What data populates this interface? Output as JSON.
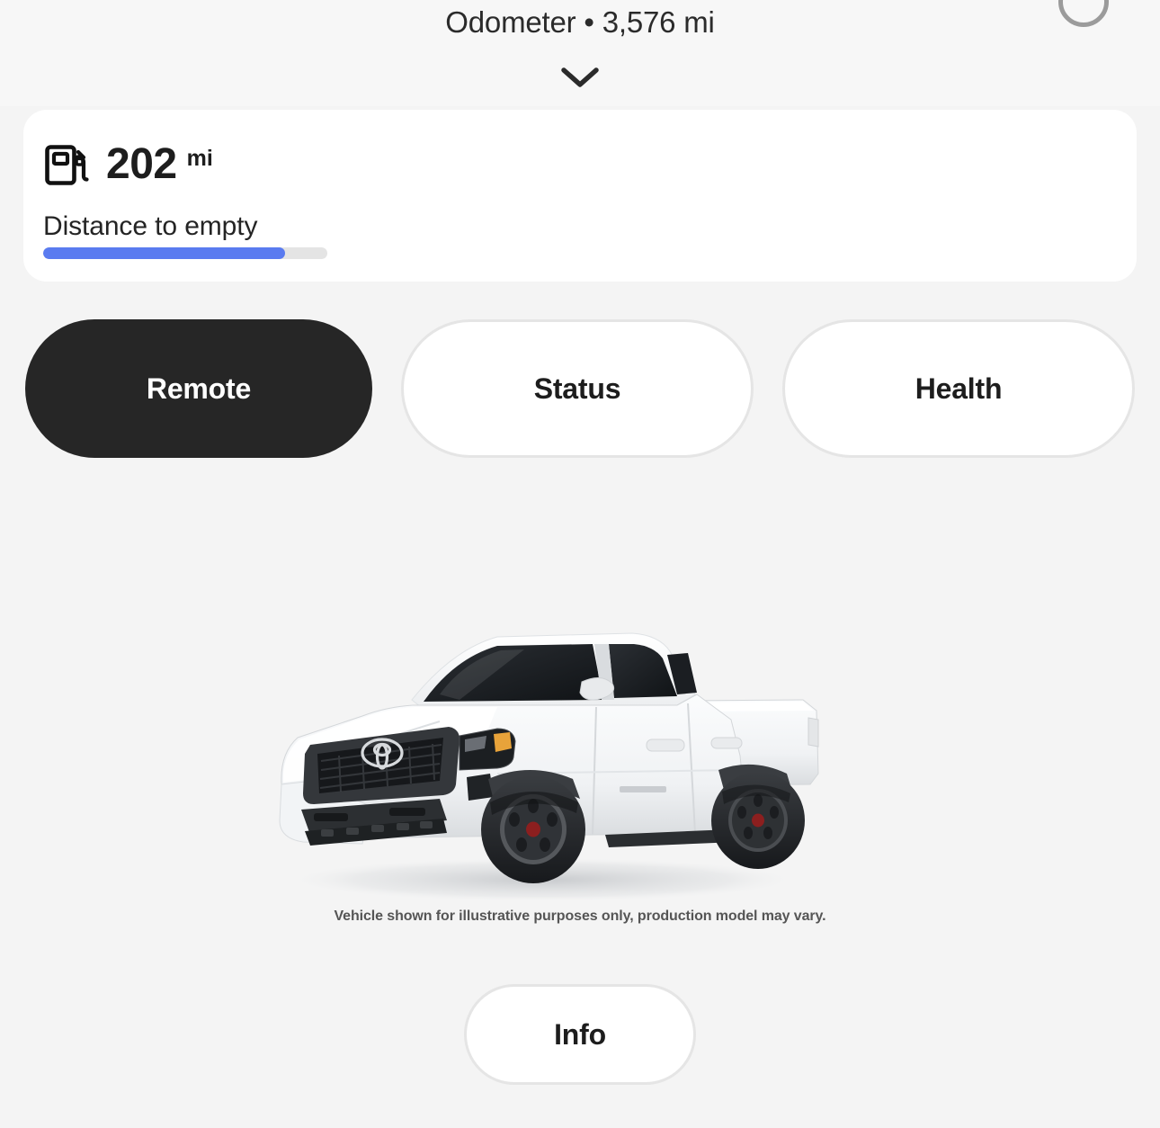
{
  "header": {
    "odometer_text": "Odometer • 3,576 mi",
    "odometer_label": "Odometer",
    "odometer_value": "3,576 mi",
    "collapse_icon": "chevron-down-icon",
    "profile_icon": "profile-avatar"
  },
  "fuel_card": {
    "icon": "fuel-pump-icon",
    "value": "202",
    "unit": "mi",
    "label": "Distance to empty",
    "progress_percent": 85,
    "fill_color": "#5a7bf0",
    "track_color": "#e4e4e4"
  },
  "tabs": [
    {
      "label": "Remote",
      "active": true
    },
    {
      "label": "Status",
      "active": false
    },
    {
      "label": "Health",
      "active": false
    }
  ],
  "vehicle": {
    "name": "toyota-tacoma-pickup",
    "body_color": "#ffffff",
    "disclaimer": "Vehicle shown for illustrative purposes only, production model may vary."
  },
  "footer": {
    "info_label": "Info"
  },
  "theme": {
    "page_background": "#f4f4f4",
    "card_background": "#ffffff",
    "active_tab_background": "#262626",
    "border_color": "#e5e5e5",
    "text_primary": "#1d1d1d"
  }
}
